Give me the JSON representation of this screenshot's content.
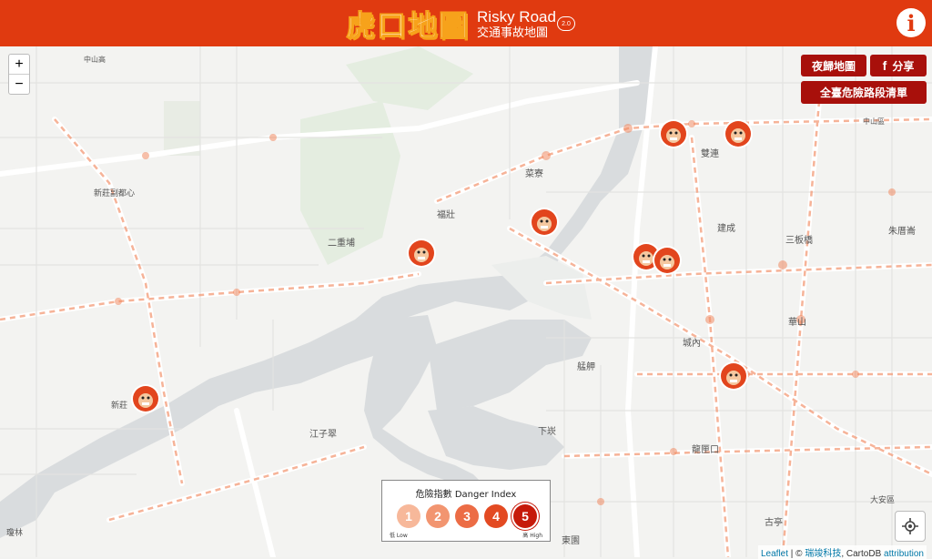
{
  "header": {
    "logo_cn": "虎口地圖",
    "logo_en": "Risky Road",
    "logo_sub": "交通事故地圖",
    "version": "2.0",
    "info_label": "i"
  },
  "controls": {
    "zoom_in": "+",
    "zoom_out": "−",
    "night_map": "夜歸地圖",
    "share": "分享",
    "share_icon": "f",
    "danger_list": "全臺危險路段清單"
  },
  "legend": {
    "title": "危險指數 Danger Index",
    "levels": [
      "1",
      "2",
      "3",
      "4",
      "5"
    ],
    "colors": [
      "#f7b89a",
      "#f29570",
      "#ec6c45",
      "#e34a22",
      "#c61a0a"
    ],
    "low": "低 Low",
    "high": "高 High"
  },
  "attribution": {
    "leaflet": "Leaflet",
    "sep": " | © ",
    "company": "瑞竣科技",
    "carto": ", CartoDB ",
    "attribution_link": "attribution"
  },
  "places": [
    {
      "name": "中山高",
      "size": 8
    },
    {
      "name": "新莊副都心",
      "size": 9
    },
    {
      "name": "二重埔",
      "size": 10
    },
    {
      "name": "福壯",
      "size": 10
    },
    {
      "name": "菜寮",
      "size": 10
    },
    {
      "name": "雙連",
      "size": 10
    },
    {
      "name": "建成",
      "size": 10
    },
    {
      "name": "三板橋",
      "size": 10
    },
    {
      "name": "朱厝崙",
      "size": 10
    },
    {
      "name": "華山",
      "size": 10
    },
    {
      "name": "城內",
      "size": 10
    },
    {
      "name": "艋舺",
      "size": 10
    },
    {
      "name": "下崁",
      "size": 10
    },
    {
      "name": "龍匣口",
      "size": 10
    },
    {
      "name": "江子翠",
      "size": 10
    },
    {
      "name": "古亭",
      "size": 10
    },
    {
      "name": "東園",
      "size": 10
    },
    {
      "name": "瓊林",
      "size": 9
    },
    {
      "name": "新莊",
      "size": 9
    },
    {
      "name": "大安區",
      "size": 9
    },
    {
      "name": "中山區",
      "size": 8
    }
  ],
  "markers": [
    "tiger-marker",
    "tiger-marker",
    "tiger-marker",
    "tiger-marker",
    "tiger-marker",
    "tiger-marker",
    "tiger-marker",
    "tiger-marker",
    "tiger-marker"
  ]
}
